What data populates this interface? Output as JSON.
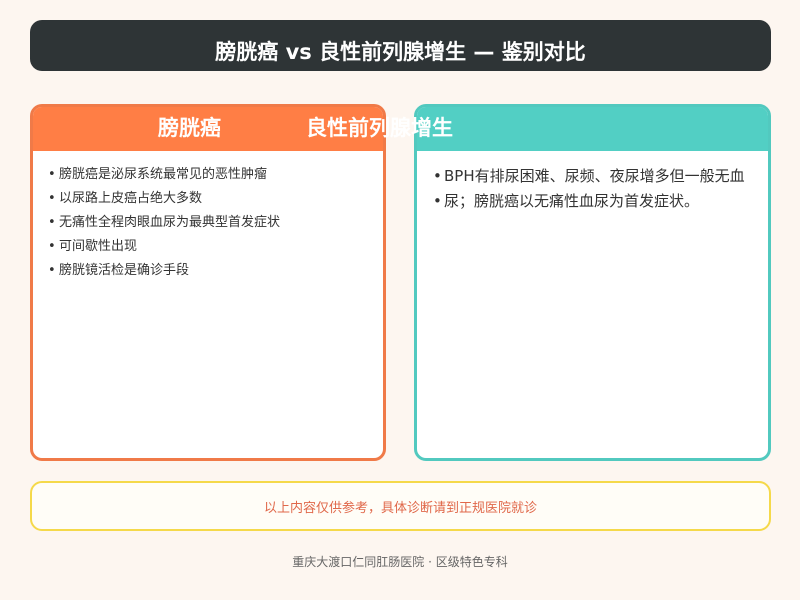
{
  "title": "膀胱癌 vs 良性前列腺增生 — 鉴别对比",
  "left_card": {
    "heading": "膀胱癌",
    "bullets": [
      "膀胱癌是泌尿系统最常见的恶性肿瘤",
      "以尿路上皮癌占绝大多数",
      "无痛性全程肉眼血尿为最典型首发症状",
      "可间歇性出现",
      "膀胱镜活检是确诊手段"
    ]
  },
  "right_card": {
    "heading": "良性前列腺增生",
    "bullets": [
      "BPH有排尿困难、尿频、夜尿增多但一般无血",
      "尿；膀胱癌以无痛性血尿为首发症状。"
    ]
  },
  "notice": "以上内容仅供参考，具体诊断请到正规医院就诊",
  "footer": "重庆大渡口仁同肛肠医院 · 区级特色专科",
  "colors": {
    "left_accent": "#ff7e45",
    "right_accent": "#52cfc4",
    "title_bg": "#2e3436",
    "notice_border": "#f5d94a"
  }
}
